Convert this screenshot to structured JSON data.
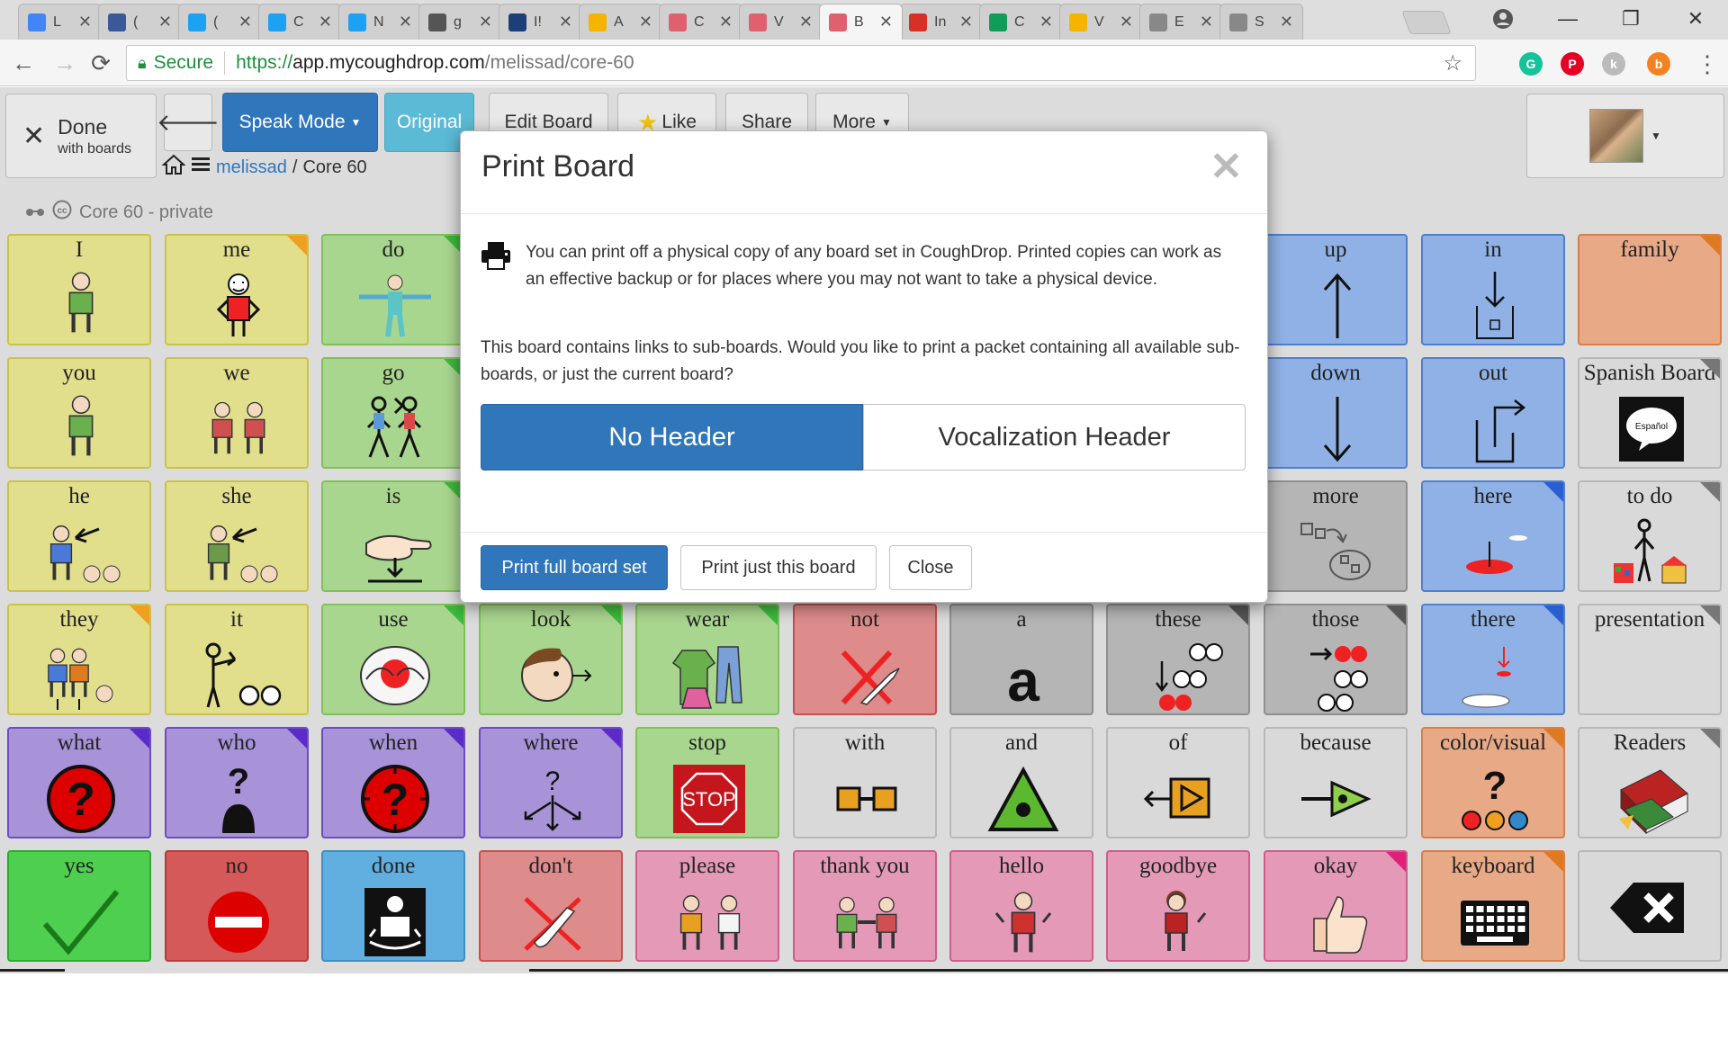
{
  "browser": {
    "tabs": [
      {
        "label": "L",
        "icon": "docs-icon",
        "color": "#4285f4"
      },
      {
        "label": "(",
        "icon": "facebook-icon",
        "color": "#3b5998"
      },
      {
        "label": "(",
        "icon": "twitter-icon",
        "color": "#1da1f2"
      },
      {
        "label": "C",
        "icon": "twitter-icon",
        "color": "#1da1f2"
      },
      {
        "label": "N",
        "icon": "twitter-icon",
        "color": "#1da1f2"
      },
      {
        "label": "g",
        "icon": "slack-icon",
        "color": "#555555"
      },
      {
        "label": "I!",
        "icon": "cas-icon",
        "color": "#1c3f7a"
      },
      {
        "label": "A",
        "icon": "analytics-icon",
        "color": "#f4b400"
      },
      {
        "label": "C",
        "icon": "coughdrop-icon",
        "color": "#e06070"
      },
      {
        "label": "V",
        "icon": "coughdrop-icon",
        "color": "#e06070"
      },
      {
        "label": "B",
        "icon": "coughdrop-icon",
        "color": "#e06070"
      },
      {
        "label": "In",
        "icon": "gmail-icon",
        "color": "#d93025"
      },
      {
        "label": "C",
        "icon": "sheets-icon",
        "color": "#0f9d58"
      },
      {
        "label": "V",
        "icon": "slides-icon",
        "color": "#f4b400"
      },
      {
        "label": "E",
        "icon": "file-icon",
        "color": "#888888"
      },
      {
        "label": "S",
        "icon": "page-icon",
        "color": "#888888"
      }
    ],
    "tab_close": "✕",
    "window_controls": {
      "minimize": "—",
      "restore": "❐",
      "close": "✕"
    },
    "address": {
      "secure_label": "Secure",
      "scheme": "https://",
      "host": "app.mycoughdrop.com",
      "path": "/melissad/core-60"
    },
    "extensions": [
      {
        "icon": "grammarly-icon",
        "color": "#15c39a",
        "glyph": "G"
      },
      {
        "icon": "pinterest-icon",
        "color": "#e60023",
        "glyph": "P"
      },
      {
        "icon": "extension-icon",
        "color": "#bbbbbb",
        "glyph": "k"
      },
      {
        "icon": "extension-icon",
        "color": "#f58220",
        "glyph": "b"
      }
    ]
  },
  "header": {
    "done_label": "Done",
    "done_sub": "with boards",
    "speak_mode": "Speak Mode",
    "original": "Original",
    "edit_board": "Edit Board",
    "like": "Like",
    "share": "Share",
    "more": "More",
    "breadcrumb_user": "melissad",
    "breadcrumb_sep": "/",
    "breadcrumb_board": "Core 60",
    "board_title": "Core 60 - private"
  },
  "colors": {
    "yellow": {
      "bg": "#e1de8c",
      "border": "#c9c34c"
    },
    "green": {
      "bg": "#a9d68e",
      "border": "#7fc057"
    },
    "purple": {
      "bg": "#a892d8",
      "border": "#6e4cc2"
    },
    "gray": {
      "bg": "#b5b5b5",
      "border": "#8f8f8f"
    },
    "lightgray": {
      "bg": "#d9d9d9",
      "border": "#b8b8b8"
    },
    "blue": {
      "bg": "#8fb1e6",
      "border": "#4f7fce"
    },
    "orange": {
      "bg": "#e8a987",
      "border": "#d77f48"
    },
    "pink": {
      "bg": "#e49ab7",
      "border": "#cf5c8b"
    },
    "red": {
      "bg": "#dd8b8b",
      "border": "#c74f4f"
    },
    "brightgreen": {
      "bg": "#4fcf4f",
      "border": "#2eab2e"
    },
    "brightred": {
      "bg": "#d65959",
      "border": "#b83a3a"
    },
    "skyblue": {
      "bg": "#61aee0",
      "border": "#3f8ec4"
    }
  },
  "grid": [
    [
      {
        "label": "I",
        "color": "yellow",
        "icon": "person-pointing-self-icon"
      },
      {
        "label": "me",
        "color": "yellow",
        "icon": "person-me-icon",
        "corner": "#f0a020"
      },
      {
        "label": "do",
        "color": "green",
        "icon": "person-arms-out-icon",
        "corner": "#3cba3c"
      },
      null,
      null,
      null,
      null,
      null,
      {
        "label": "up",
        "color": "blue",
        "icon": "arrow-up-icon"
      },
      {
        "label": "in",
        "color": "blue",
        "icon": "arrow-into-box-icon"
      },
      {
        "label": "family",
        "color": "orange",
        "icon": "family-icon",
        "corner": "#e07a20"
      }
    ],
    [
      {
        "label": "you",
        "color": "yellow",
        "icon": "person-pointing-you-icon"
      },
      {
        "label": "we",
        "color": "yellow",
        "icon": "two-people-icon"
      },
      {
        "label": "go",
        "color": "green",
        "icon": "people-walking-icon",
        "corner": "#3cba3c"
      },
      null,
      null,
      null,
      null,
      null,
      {
        "label": "down",
        "color": "blue",
        "icon": "arrow-down-icon"
      },
      {
        "label": "out",
        "color": "blue",
        "icon": "arrow-out-of-box-icon"
      },
      {
        "label": "Spanish Board",
        "color": "lightgray",
        "icon": "speech-bubble-espanol-icon",
        "icon_text": "Español",
        "corner": "#777777"
      }
    ],
    [
      {
        "label": "he",
        "color": "yellow",
        "icon": "boy-pointed-icon"
      },
      {
        "label": "she",
        "color": "yellow",
        "icon": "girl-pointed-icon"
      },
      {
        "label": "is",
        "color": "green",
        "icon": "hand-down-icon",
        "corner": "#3cba3c"
      },
      null,
      null,
      null,
      null,
      null,
      {
        "label": "more",
        "color": "gray",
        "icon": "more-shapes-icon"
      },
      {
        "label": "here",
        "color": "blue",
        "icon": "here-spot-icon",
        "corner": "#2a5fcf"
      },
      {
        "label": "to do",
        "color": "lightgray",
        "icon": "todo-person-icon",
        "corner": "#777777"
      }
    ],
    [
      {
        "label": "they",
        "color": "yellow",
        "icon": "group-people-icon",
        "corner": "#f0a020"
      },
      {
        "label": "it",
        "color": "yellow",
        "icon": "person-pointing-it-icon"
      },
      {
        "label": "use",
        "color": "green",
        "icon": "hands-ball-icon",
        "corner": "#3cba3c"
      },
      {
        "label": "look",
        "color": "green",
        "icon": "face-looking-icon",
        "corner": "#3cba3c"
      },
      {
        "label": "wear",
        "color": "green",
        "icon": "clothes-icon",
        "corner": "#3cba3c"
      },
      {
        "label": "not",
        "color": "red",
        "icon": "not-cross-icon"
      },
      {
        "label": "a",
        "color": "gray",
        "icon": "letter-a-icon",
        "icon_text": "a"
      },
      {
        "label": "these",
        "color": "gray",
        "icon": "these-circles-icon",
        "corner": "#555555"
      },
      {
        "label": "those",
        "color": "gray",
        "icon": "those-circles-icon",
        "corner": "#555555"
      },
      {
        "label": "there",
        "color": "blue",
        "icon": "there-spot-icon",
        "corner": "#2a5fcf"
      },
      {
        "label": "presentation",
        "color": "lightgray",
        "icon": "",
        "corner": "#777777"
      }
    ],
    [
      {
        "label": "what",
        "color": "purple",
        "icon": "question-circle-icon",
        "corner": "#5a2bc9"
      },
      {
        "label": "who",
        "color": "purple",
        "icon": "question-person-icon",
        "corner": "#5a2bc9"
      },
      {
        "label": "when",
        "color": "purple",
        "icon": "question-clock-icon",
        "corner": "#5a2bc9"
      },
      {
        "label": "where",
        "color": "purple",
        "icon": "question-arrows-icon",
        "corner": "#5a2bc9"
      },
      {
        "label": "stop",
        "color": "green",
        "icon": "stop-sign-icon",
        "icon_text": "STOP"
      },
      {
        "label": "with",
        "color": "lightgray",
        "icon": "with-boxes-icon"
      },
      {
        "label": "and",
        "color": "lightgray",
        "icon": "and-triangle-icon"
      },
      {
        "label": "of",
        "color": "lightgray",
        "icon": "of-arrow-box-icon"
      },
      {
        "label": "because",
        "color": "lightgray",
        "icon": "because-arrow-icon"
      },
      {
        "label": "color/visual",
        "color": "orange",
        "icon": "color-question-icon",
        "corner": "#e07a20"
      },
      {
        "label": "Readers",
        "color": "lightgray",
        "icon": "books-icon",
        "corner": "#777777"
      }
    ],
    [
      {
        "label": "yes",
        "color": "brightgreen",
        "icon": "checkmark-icon"
      },
      {
        "label": "no",
        "color": "brightred",
        "icon": "no-entry-icon"
      },
      {
        "label": "done",
        "color": "skyblue",
        "icon": "done-person-icon"
      },
      {
        "label": "don't",
        "color": "red",
        "icon": "dont-hand-icon"
      },
      {
        "label": "please",
        "color": "pink",
        "icon": "please-people-icon"
      },
      {
        "label": "thank you",
        "color": "pink",
        "icon": "handshake-icon"
      },
      {
        "label": "hello",
        "color": "pink",
        "icon": "hello-girl-icon"
      },
      {
        "label": "goodbye",
        "color": "pink",
        "icon": "goodbye-girl-icon"
      },
      {
        "label": "okay",
        "color": "pink",
        "icon": "thumbs-up-icon",
        "corner": "#e0207a"
      },
      {
        "label": "keyboard",
        "color": "orange",
        "icon": "keyboard-icon",
        "corner": "#e07a20"
      },
      {
        "label": "",
        "color": "lightgray",
        "icon": "backspace-icon"
      }
    ]
  ],
  "modal": {
    "title": "Print Board",
    "close_glyph": "✕",
    "intro": "You can print off a physical copy of any board set in CoughDrop. Printed copies can work as an effective backup or for places where you may not want to take a physical device.",
    "question": "This board contains links to sub-boards. Would you like to print a packet containing all available sub-boards, or just the current board?",
    "option_selected": "No Header",
    "option_other": "Vocalization Header",
    "btn_full": "Print full board set",
    "btn_this": "Print just this board",
    "btn_close": "Close"
  }
}
